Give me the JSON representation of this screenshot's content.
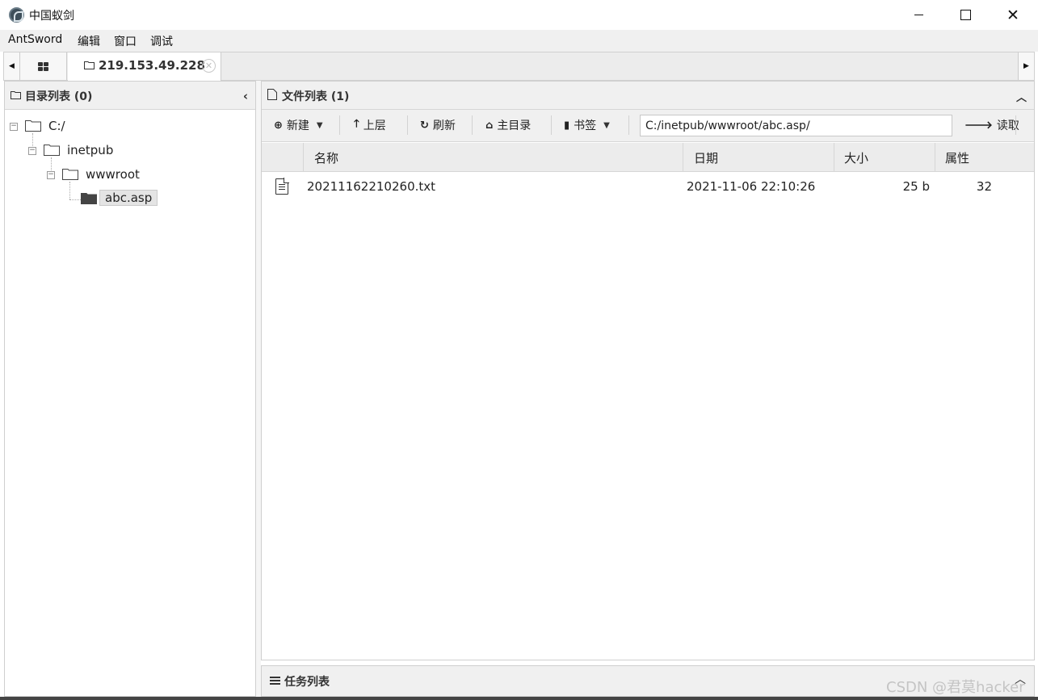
{
  "window": {
    "title": "中国蚁剑",
    "icons": [
      "app-logo",
      "minimize-icon",
      "maximize-icon",
      "close-icon"
    ]
  },
  "menu": [
    "AntSword",
    "编辑",
    "窗口",
    "调试"
  ],
  "tabs": {
    "active_label": "219.153.49.228"
  },
  "directory_panel": {
    "title": "目录列表 (0)",
    "tree": [
      {
        "label": "C:/",
        "level": 0
      },
      {
        "label": "inetpub",
        "level": 1
      },
      {
        "label": "wwwroot",
        "level": 2
      },
      {
        "label": "abc.asp",
        "level": 3,
        "selected": true
      }
    ]
  },
  "file_panel": {
    "title": "文件列表 (1)",
    "toolbar": {
      "new_label": "新建",
      "up_label": "上层",
      "refresh_label": "刷新",
      "home_label": "主目录",
      "bookmark_label": "书签",
      "path_value": "C:/inetpub/wwwroot/abc.asp/",
      "read_label": "读取"
    },
    "columns": [
      "名称",
      "日期",
      "大小",
      "属性"
    ],
    "rows": [
      {
        "name": "20211162210260.txt",
        "date": "2021-11-06 22:10:26",
        "size": "25 b",
        "attr": "32"
      }
    ]
  },
  "task_panel": {
    "title": "任务列表"
  },
  "watermark": "CSDN @君莫hacker"
}
